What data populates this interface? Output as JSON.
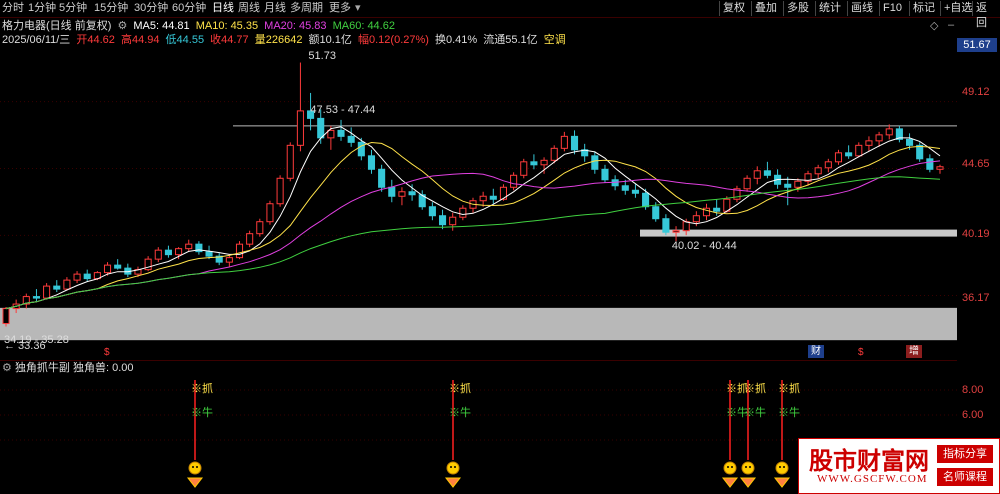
{
  "period_tabs": [
    {
      "label": "分时",
      "active": false
    },
    {
      "label": "1分钟",
      "active": false
    },
    {
      "label": "5分钟",
      "active": false
    },
    {
      "label": "15分钟",
      "active": false
    },
    {
      "label": "30分钟",
      "active": false
    },
    {
      "label": "60分钟",
      "active": false
    },
    {
      "label": "日线",
      "active": true
    },
    {
      "label": "周线",
      "active": false
    },
    {
      "label": "月线",
      "active": false
    },
    {
      "label": "多周期",
      "active": false
    },
    {
      "label": "更多",
      "active": false
    }
  ],
  "toolbar_buttons": [
    "复权",
    "叠加",
    "多股",
    "统计",
    "画线",
    "F10",
    "标记",
    "+自选",
    "返回"
  ],
  "stock": {
    "title": "格力电器(日线 前复权)",
    "ma5_label": "MA5: 44.81",
    "ma10_label": "MA10: 45.35",
    "ma20_label": "MA20: 45.83",
    "ma60_label": "MA60: 44.62"
  },
  "quote": {
    "date": "2025/06/11/三",
    "open": "开44.62",
    "high": "高44.94",
    "low": "低44.55",
    "close": "收44.77",
    "volume": "量226642",
    "amount": "额10.1亿",
    "change": "幅0.12(0.27%)",
    "turnover": "换0.41%",
    "float_cap": "流通55.1亿",
    "status": "空调"
  },
  "price_axis": {
    "current": "51.67",
    "labels": [
      "49.12",
      "44.65",
      "40.19",
      "36.17"
    ]
  },
  "annotations": {
    "high_label": "51.73",
    "low_label": "33.36",
    "upper_range": "47.53 - 47.44",
    "mid_range": "40.02 - 40.44",
    "lower_range": "34.19 - 35.28",
    "markers": [
      "$",
      "财",
      "$",
      "增"
    ]
  },
  "indicator": {
    "name": "独角抓牛副",
    "value_label": "独角兽: 0.00",
    "axis_labels": [
      "8.00",
      "6.00"
    ],
    "signal_top": "※抓",
    "signal_bottom": "※牛"
  },
  "watermark": {
    "site_name": "股市财富网",
    "url": "WWW.GSCFW.COM",
    "tag1": "指标分享",
    "tag2": "名师课程"
  },
  "colors": {
    "up": "#ff3b3b",
    "down": "#36c8d8",
    "ma5": "#ffffff",
    "ma10": "#ffe24a",
    "ma20": "#e040e0",
    "ma60": "#40d040",
    "accent_blue": "#1e3f8c"
  },
  "chart_data": {
    "type": "candlestick",
    "y_range": [
      33.0,
      52.5
    ],
    "candles": [
      [
        34.3,
        35.4,
        34.1,
        35.3
      ],
      [
        35.3,
        35.9,
        35.0,
        35.6
      ],
      [
        35.6,
        36.3,
        35.3,
        36.1
      ],
      [
        36.1,
        36.6,
        35.8,
        36.0
      ],
      [
        36.0,
        37.0,
        35.9,
        36.8
      ],
      [
        36.8,
        37.2,
        36.4,
        36.6
      ],
      [
        36.6,
        37.4,
        36.5,
        37.2
      ],
      [
        37.2,
        37.8,
        37.0,
        37.6
      ],
      [
        37.6,
        37.9,
        37.1,
        37.3
      ],
      [
        37.3,
        37.8,
        37.2,
        37.7
      ],
      [
        37.7,
        38.4,
        37.5,
        38.2
      ],
      [
        38.2,
        38.6,
        37.9,
        38.0
      ],
      [
        38.0,
        38.3,
        37.4,
        37.6
      ],
      [
        37.6,
        38.1,
        37.4,
        37.9
      ],
      [
        37.9,
        38.8,
        37.8,
        38.6
      ],
      [
        38.6,
        39.4,
        38.4,
        39.2
      ],
      [
        39.2,
        39.5,
        38.7,
        38.9
      ],
      [
        38.9,
        39.4,
        38.6,
        39.3
      ],
      [
        39.3,
        39.9,
        39.1,
        39.6
      ],
      [
        39.6,
        39.8,
        38.9,
        39.1
      ],
      [
        39.1,
        39.5,
        38.6,
        38.8
      ],
      [
        38.8,
        39.0,
        38.2,
        38.4
      ],
      [
        38.4,
        38.9,
        38.1,
        38.7
      ],
      [
        38.7,
        39.8,
        38.6,
        39.6
      ],
      [
        39.6,
        40.5,
        39.4,
        40.3
      ],
      [
        40.3,
        41.3,
        40.1,
        41.1
      ],
      [
        41.1,
        42.5,
        40.9,
        42.3
      ],
      [
        42.3,
        44.2,
        42.1,
        44.0
      ],
      [
        44.0,
        46.4,
        43.8,
        46.2
      ],
      [
        46.2,
        51.73,
        45.8,
        48.5
      ],
      [
        48.5,
        49.7,
        47.2,
        48.0
      ],
      [
        48.0,
        48.6,
        46.3,
        46.7
      ],
      [
        46.7,
        47.5,
        45.9,
        47.2
      ],
      [
        47.2,
        47.9,
        46.5,
        46.8
      ],
      [
        46.8,
        47.4,
        46.1,
        46.4
      ],
      [
        46.4,
        46.7,
        45.2,
        45.5
      ],
      [
        45.5,
        45.9,
        44.3,
        44.6
      ],
      [
        44.6,
        44.9,
        43.1,
        43.4
      ],
      [
        43.4,
        43.9,
        42.4,
        42.8
      ],
      [
        42.8,
        43.4,
        42.2,
        43.1
      ],
      [
        43.1,
        43.6,
        42.5,
        42.9
      ],
      [
        42.9,
        43.2,
        41.9,
        42.1
      ],
      [
        42.1,
        42.4,
        41.2,
        41.5
      ],
      [
        41.5,
        41.9,
        40.6,
        40.9
      ],
      [
        40.9,
        41.7,
        40.5,
        41.4
      ],
      [
        41.4,
        42.2,
        41.2,
        42.0
      ],
      [
        42.0,
        42.7,
        41.7,
        42.5
      ],
      [
        42.5,
        43.1,
        42.1,
        42.8
      ],
      [
        42.8,
        43.3,
        42.3,
        42.6
      ],
      [
        42.6,
        43.6,
        42.5,
        43.4
      ],
      [
        43.4,
        44.4,
        43.2,
        44.2
      ],
      [
        44.2,
        45.3,
        44.0,
        45.1
      ],
      [
        45.1,
        45.6,
        44.6,
        44.9
      ],
      [
        44.9,
        45.4,
        44.3,
        45.2
      ],
      [
        45.2,
        46.2,
        45.0,
        46.0
      ],
      [
        46.0,
        47.1,
        45.8,
        46.8
      ],
      [
        46.8,
        47.2,
        45.6,
        45.9
      ],
      [
        45.9,
        46.3,
        45.1,
        45.5
      ],
      [
        45.5,
        45.8,
        44.3,
        44.6
      ],
      [
        44.6,
        44.9,
        43.7,
        43.9
      ],
      [
        43.9,
        44.2,
        43.2,
        43.5
      ],
      [
        43.5,
        43.9,
        42.9,
        43.2
      ],
      [
        43.2,
        43.6,
        42.7,
        43.0
      ],
      [
        43.0,
        43.3,
        41.9,
        42.1
      ],
      [
        42.1,
        42.4,
        41.1,
        41.3
      ],
      [
        41.3,
        41.6,
        40.2,
        40.4
      ],
      [
        40.4,
        40.8,
        39.8,
        40.5
      ],
      [
        40.5,
        41.3,
        40.2,
        41.1
      ],
      [
        41.1,
        41.8,
        40.8,
        41.5
      ],
      [
        41.5,
        42.3,
        41.2,
        42.0
      ],
      [
        42.0,
        42.6,
        41.5,
        41.8
      ],
      [
        41.8,
        42.8,
        41.7,
        42.6
      ],
      [
        42.6,
        43.5,
        42.4,
        43.3
      ],
      [
        43.3,
        44.2,
        43.1,
        44.0
      ],
      [
        44.0,
        44.8,
        43.6,
        44.5
      ],
      [
        44.5,
        45.1,
        44.0,
        44.2
      ],
      [
        44.2,
        44.6,
        43.3,
        43.6
      ],
      [
        43.6,
        44.1,
        42.2,
        43.4
      ],
      [
        43.4,
        44.0,
        43.1,
        43.8
      ],
      [
        43.8,
        44.5,
        43.5,
        44.3
      ],
      [
        44.3,
        44.9,
        44.0,
        44.7
      ],
      [
        44.7,
        45.3,
        44.4,
        45.1
      ],
      [
        45.1,
        45.9,
        44.9,
        45.7
      ],
      [
        45.7,
        46.2,
        45.3,
        45.5
      ],
      [
        45.5,
        46.4,
        45.4,
        46.2
      ],
      [
        46.2,
        46.8,
        45.8,
        46.5
      ],
      [
        46.5,
        47.1,
        46.1,
        46.9
      ],
      [
        46.9,
        47.6,
        46.6,
        47.3
      ],
      [
        47.3,
        47.5,
        46.4,
        46.6
      ],
      [
        46.6,
        47.0,
        45.9,
        46.2
      ],
      [
        46.2,
        46.4,
        45.1,
        45.3
      ],
      [
        45.3,
        45.6,
        44.4,
        44.6
      ],
      [
        44.6,
        44.9,
        44.3,
        44.77
      ]
    ]
  }
}
